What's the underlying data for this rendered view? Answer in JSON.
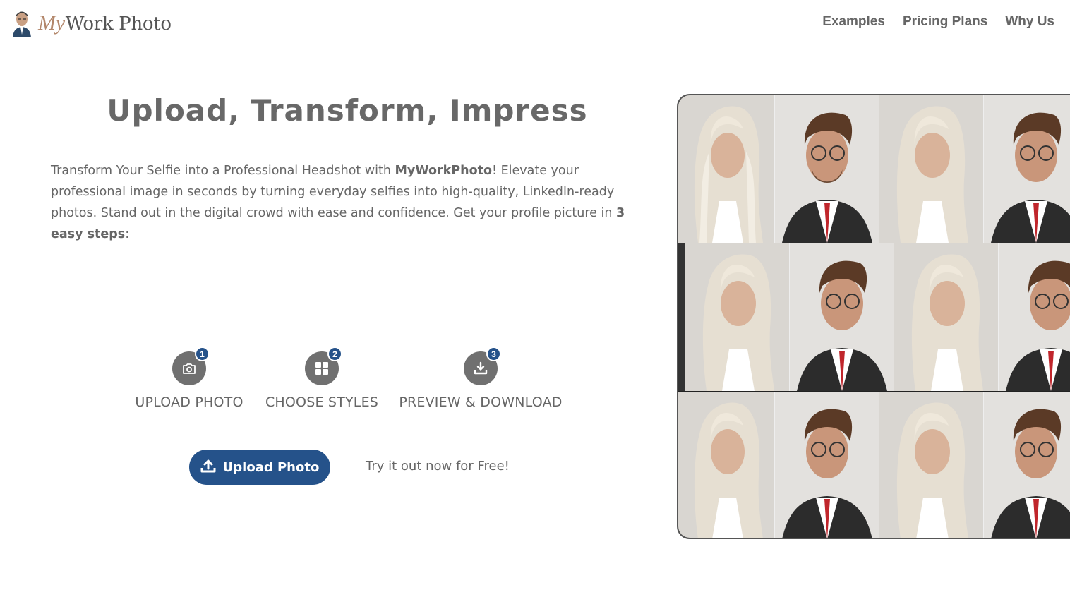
{
  "header": {
    "logo_text_my": "My",
    "logo_text_rest": "Work Photo",
    "nav": [
      "Examples",
      "Pricing Plans",
      "Why Us"
    ]
  },
  "hero": {
    "title": "Upload, Transform, Impress",
    "intro_part1": "Transform Your Selfie into a Professional Headshot with ",
    "intro_brand": "MyWorkPhoto",
    "intro_part2": "! Elevate your professional image in seconds by turning everyday selfies into high-quality, LinkedIn-ready photos. Stand out in the digital crowd with ease and confidence. Get your profile picture in ",
    "intro_steps": "3 easy steps",
    "intro_end": ":"
  },
  "steps": [
    {
      "number": "1",
      "label": "UPLOAD PHOTO",
      "icon": "camera-icon"
    },
    {
      "number": "2",
      "label": "CHOOSE STYLES",
      "icon": "grid-icon"
    },
    {
      "number": "3",
      "label": "PREVIEW & DOWNLOAD",
      "icon": "download-icon"
    }
  ],
  "cta": {
    "upload_label": "Upload Photo",
    "try_label": "Try it out now for Free!"
  },
  "colors": {
    "accent": "#25528a",
    "text": "#666666",
    "icon_bg": "#707070"
  }
}
